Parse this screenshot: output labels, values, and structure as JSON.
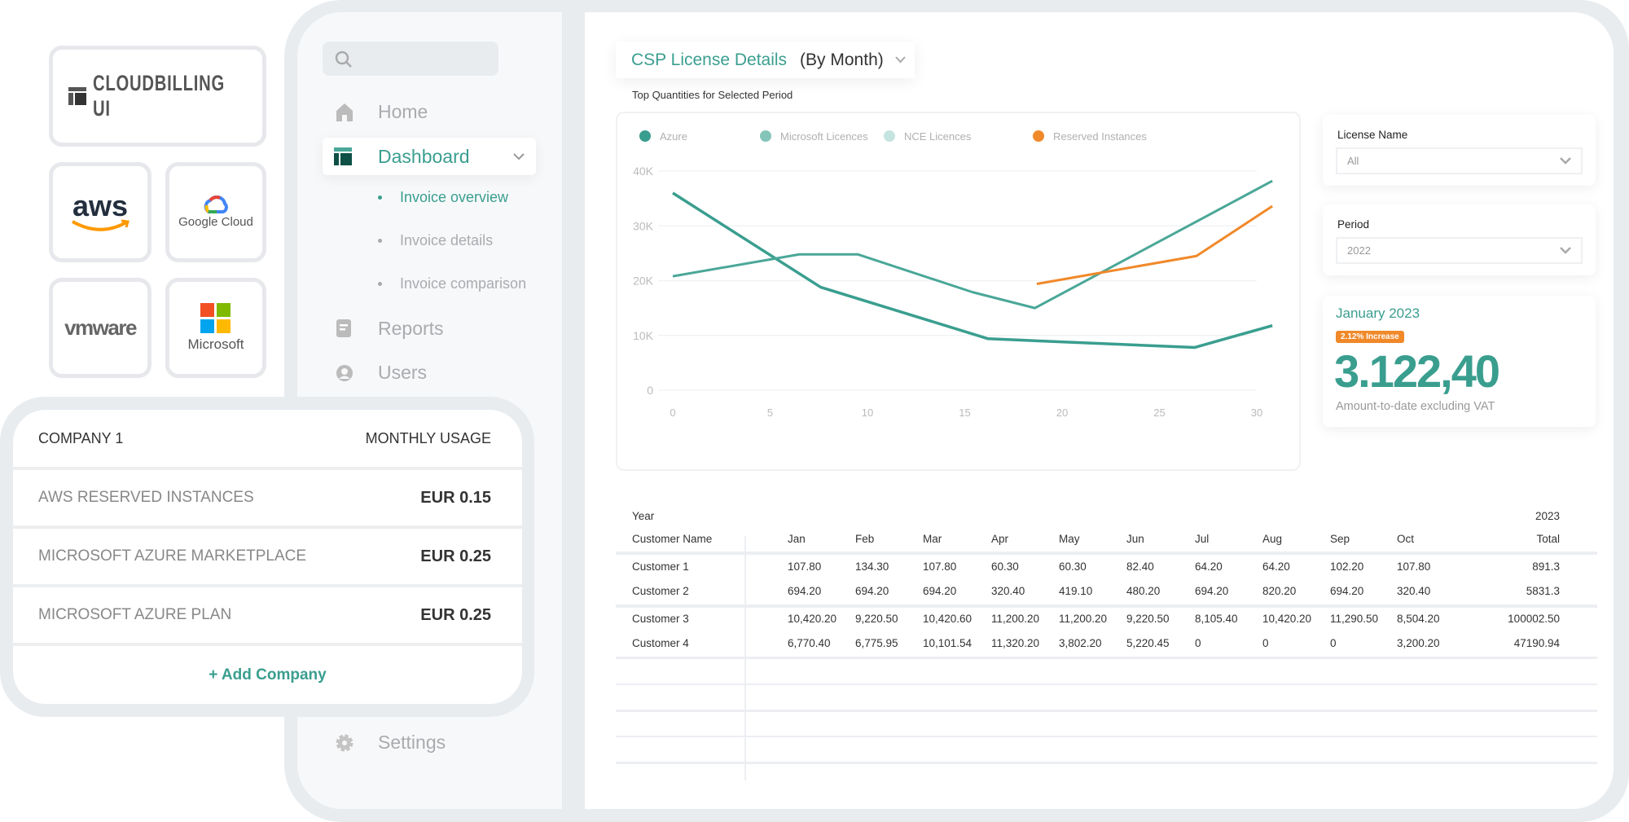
{
  "brand": {
    "name": "CLOUDBILLING UI"
  },
  "providers": [
    {
      "name": "aws"
    },
    {
      "name": "Google Cloud"
    },
    {
      "name": "vmware"
    },
    {
      "name": "Microsoft"
    }
  ],
  "sidebar": {
    "search_placeholder": "",
    "items": [
      {
        "label": "Home",
        "icon": "home-icon"
      },
      {
        "label": "Dashboard",
        "icon": "dashboard-icon",
        "active": true
      },
      {
        "label": "Reports",
        "icon": "report-icon"
      },
      {
        "label": "Users",
        "icon": "user-icon"
      },
      {
        "label": "Settings",
        "icon": "gear-icon"
      }
    ],
    "subitems": [
      {
        "label": "Invoice overview",
        "active": true
      },
      {
        "label": "Invoice details"
      },
      {
        "label": "Invoice comparison"
      }
    ]
  },
  "company": {
    "header": "COMPANY 1",
    "header_right": "MONTHLY USAGE",
    "rows": [
      {
        "name": "AWS RESERVED INSTANCES",
        "value": "EUR 0.15"
      },
      {
        "name": "MICROSOFT AZURE MARKETPLACE",
        "value": "EUR 0.25"
      },
      {
        "name": "MICROSOFT AZURE PLAN",
        "value": "EUR 0.25"
      }
    ],
    "add_label": "+ Add Company"
  },
  "main": {
    "title": "CSP License Details",
    "title_suffix": "(By Month)",
    "subtitle": "Top Quantities for Selected Period"
  },
  "filters": {
    "license_label": "License Name",
    "license_value": "All",
    "period_label": "Period",
    "period_value": "2022"
  },
  "summary": {
    "month": "January 2023",
    "badge": "2.12% Increase",
    "amount": "3.122,40",
    "caption": "Amount-to-date excluding VAT"
  },
  "colors": {
    "accent": "#3a9e8f",
    "orange": "#f0892a",
    "frame": "#e9ecef"
  },
  "chart_data": {
    "type": "line",
    "xlim": [
      0,
      30
    ],
    "ylim": [
      0,
      40000
    ],
    "xticks": [
      "0",
      "5",
      "10",
      "15",
      "20",
      "25",
      "30"
    ],
    "yticks": [
      "0",
      "10K",
      "20K",
      "30K",
      "40K"
    ],
    "legend_position": "top-left",
    "grid": true,
    "series": [
      {
        "name": "Azure",
        "color": "#3a9e8f",
        "points": [
          [
            0,
            36000
          ],
          [
            7.6,
            18800
          ],
          [
            16.2,
            9400
          ],
          [
            26.8,
            7800
          ],
          [
            30.8,
            11800
          ]
        ]
      },
      {
        "name": "Microsoft Licences",
        "color": "#84c4b9",
        "line_color": "#4aa798",
        "points": [
          [
            0,
            20800
          ],
          [
            6.5,
            24800
          ],
          [
            9.5,
            24800
          ],
          [
            15.4,
            17900
          ],
          [
            18.6,
            15000
          ],
          [
            30.8,
            38200
          ]
        ]
      },
      {
        "name": "NCE Licences",
        "color": "#c5e4df",
        "points": []
      },
      {
        "name": "Reserved Instances",
        "color": "#f0892a",
        "points": [
          [
            18.7,
            19400
          ],
          [
            26.9,
            24500
          ],
          [
            30.8,
            33600
          ]
        ]
      }
    ]
  },
  "table": {
    "year_label": "Year",
    "year_value": "2023",
    "columns": [
      "Customer Name",
      "Jan",
      "Feb",
      "Mar",
      "Apr",
      "May",
      "Jun",
      "Jul",
      "Aug",
      "Sep",
      "Oct",
      "Total"
    ],
    "rows": [
      [
        "Customer 1",
        "107.80",
        "134.30",
        "107.80",
        "60.30",
        "60.30",
        "82.40",
        "64.20",
        "64.20",
        "102.20",
        "107.80",
        "891.3"
      ],
      [
        "Customer 2",
        "694.20",
        "694.20",
        "694.20",
        "320.40",
        "419.10",
        "480.20",
        "694.20",
        "820.20",
        "694.20",
        "320.40",
        "5831.3"
      ],
      [
        "Customer 3",
        "10,420.20",
        "9,220.50",
        "10,420.60",
        "11,200.20",
        "11,200.20",
        "9,220.50",
        "8,105.40",
        "10,420.20",
        "11,290.50",
        "8,504.20",
        "100002.50"
      ],
      [
        "Customer 4",
        "6,770.40",
        "6,775.95",
        "10,101.54",
        "11,320.20",
        "3,802.20",
        "5,220.45",
        "0",
        "0",
        "0",
        "3,200.20",
        "47190.94"
      ]
    ]
  }
}
